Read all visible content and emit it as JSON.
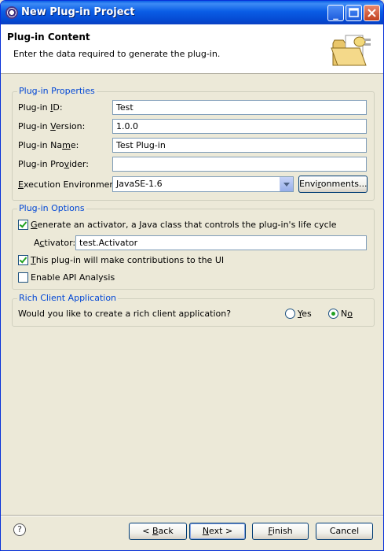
{
  "window": {
    "title": "New Plug-in Project"
  },
  "header": {
    "title": "Plug-in Content",
    "description": "Enter the data required to generate the plug-in.",
    "icon": "folder-plugin-icon"
  },
  "properties": {
    "legend": "Plug-in Properties",
    "id_label": "Plug-in ID:",
    "id_value": "Test",
    "version_label": "Plug-in Version:",
    "version_value": "1.0.0",
    "name_label": "Plug-in Name:",
    "name_value": "Test Plug-in",
    "provider_label": "Plug-in Provider:",
    "provider_value": "",
    "env_label": "Execution Environment:",
    "env_value": "JavaSE-1.6",
    "env_button": "Environments..."
  },
  "options": {
    "legend": "Plug-in Options",
    "activator_check": "Generate an activator, a Java class that controls the plug-in's life cycle",
    "activator_checked": true,
    "activator_label": "Activator:",
    "activator_value": "test.Activator",
    "ui_check": "This plug-in will make contributions to the UI",
    "ui_checked": true,
    "api_check": "Enable API Analysis",
    "api_checked": false
  },
  "rcp": {
    "legend": "Rich Client Application",
    "question": "Would you like to create a rich client application?",
    "yes": "Yes",
    "no": "No",
    "selected": "No"
  },
  "footer": {
    "back": "< Back",
    "next": "Next >",
    "finish": "Finish",
    "cancel": "Cancel"
  },
  "colors": {
    "title_bar": "#0a5de6",
    "group_legend": "#0046d5",
    "check_mark": "#21a121"
  }
}
